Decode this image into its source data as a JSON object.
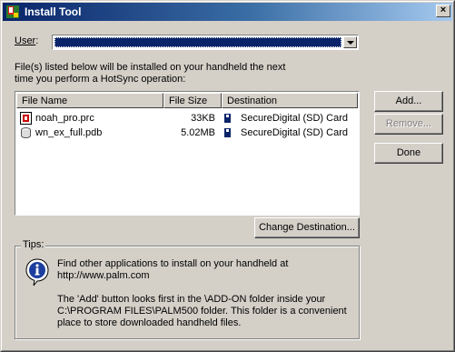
{
  "window": {
    "title": "Install Tool",
    "close_glyph": "×"
  },
  "user": {
    "label": "User",
    "label_suffix": ":",
    "selected_value": ""
  },
  "description": {
    "line1": "File(s) listed below will be installed on your handheld the next",
    "line2": "time you perform a HotSync operation:"
  },
  "table": {
    "columns": [
      "File Name",
      "File Size",
      "Destination"
    ],
    "rows": [
      {
        "icon": "prc-file-icon",
        "name": "noah_pro.prc",
        "size": "33KB",
        "destination": "SecureDigital (SD) Card"
      },
      {
        "icon": "pdb-file-icon",
        "name": "wn_ex_full.pdb",
        "size": "5.02MB",
        "destination": "SecureDigital (SD) Card"
      }
    ]
  },
  "buttons": {
    "add": "Add...",
    "remove": "Remove...",
    "done": "Done",
    "change_destination": "Change Destination..."
  },
  "tips": {
    "title": "Tips:",
    "lines": [
      "Find other applications to install on your handheld at",
      "http://www.palm.com",
      "",
      "The 'Add' button looks first in the \\ADD-ON folder inside your",
      "C:\\PROGRAM FILES\\PALM500 folder. This folder is a convenient",
      "place to store downloaded handheld files."
    ]
  },
  "colors": {
    "title_bar_start": "#0a246a",
    "title_bar_end": "#a6caf0",
    "dialog_face": "#d4d0c8",
    "selection": "#0a246a",
    "info_icon": "#1c3f9e"
  }
}
